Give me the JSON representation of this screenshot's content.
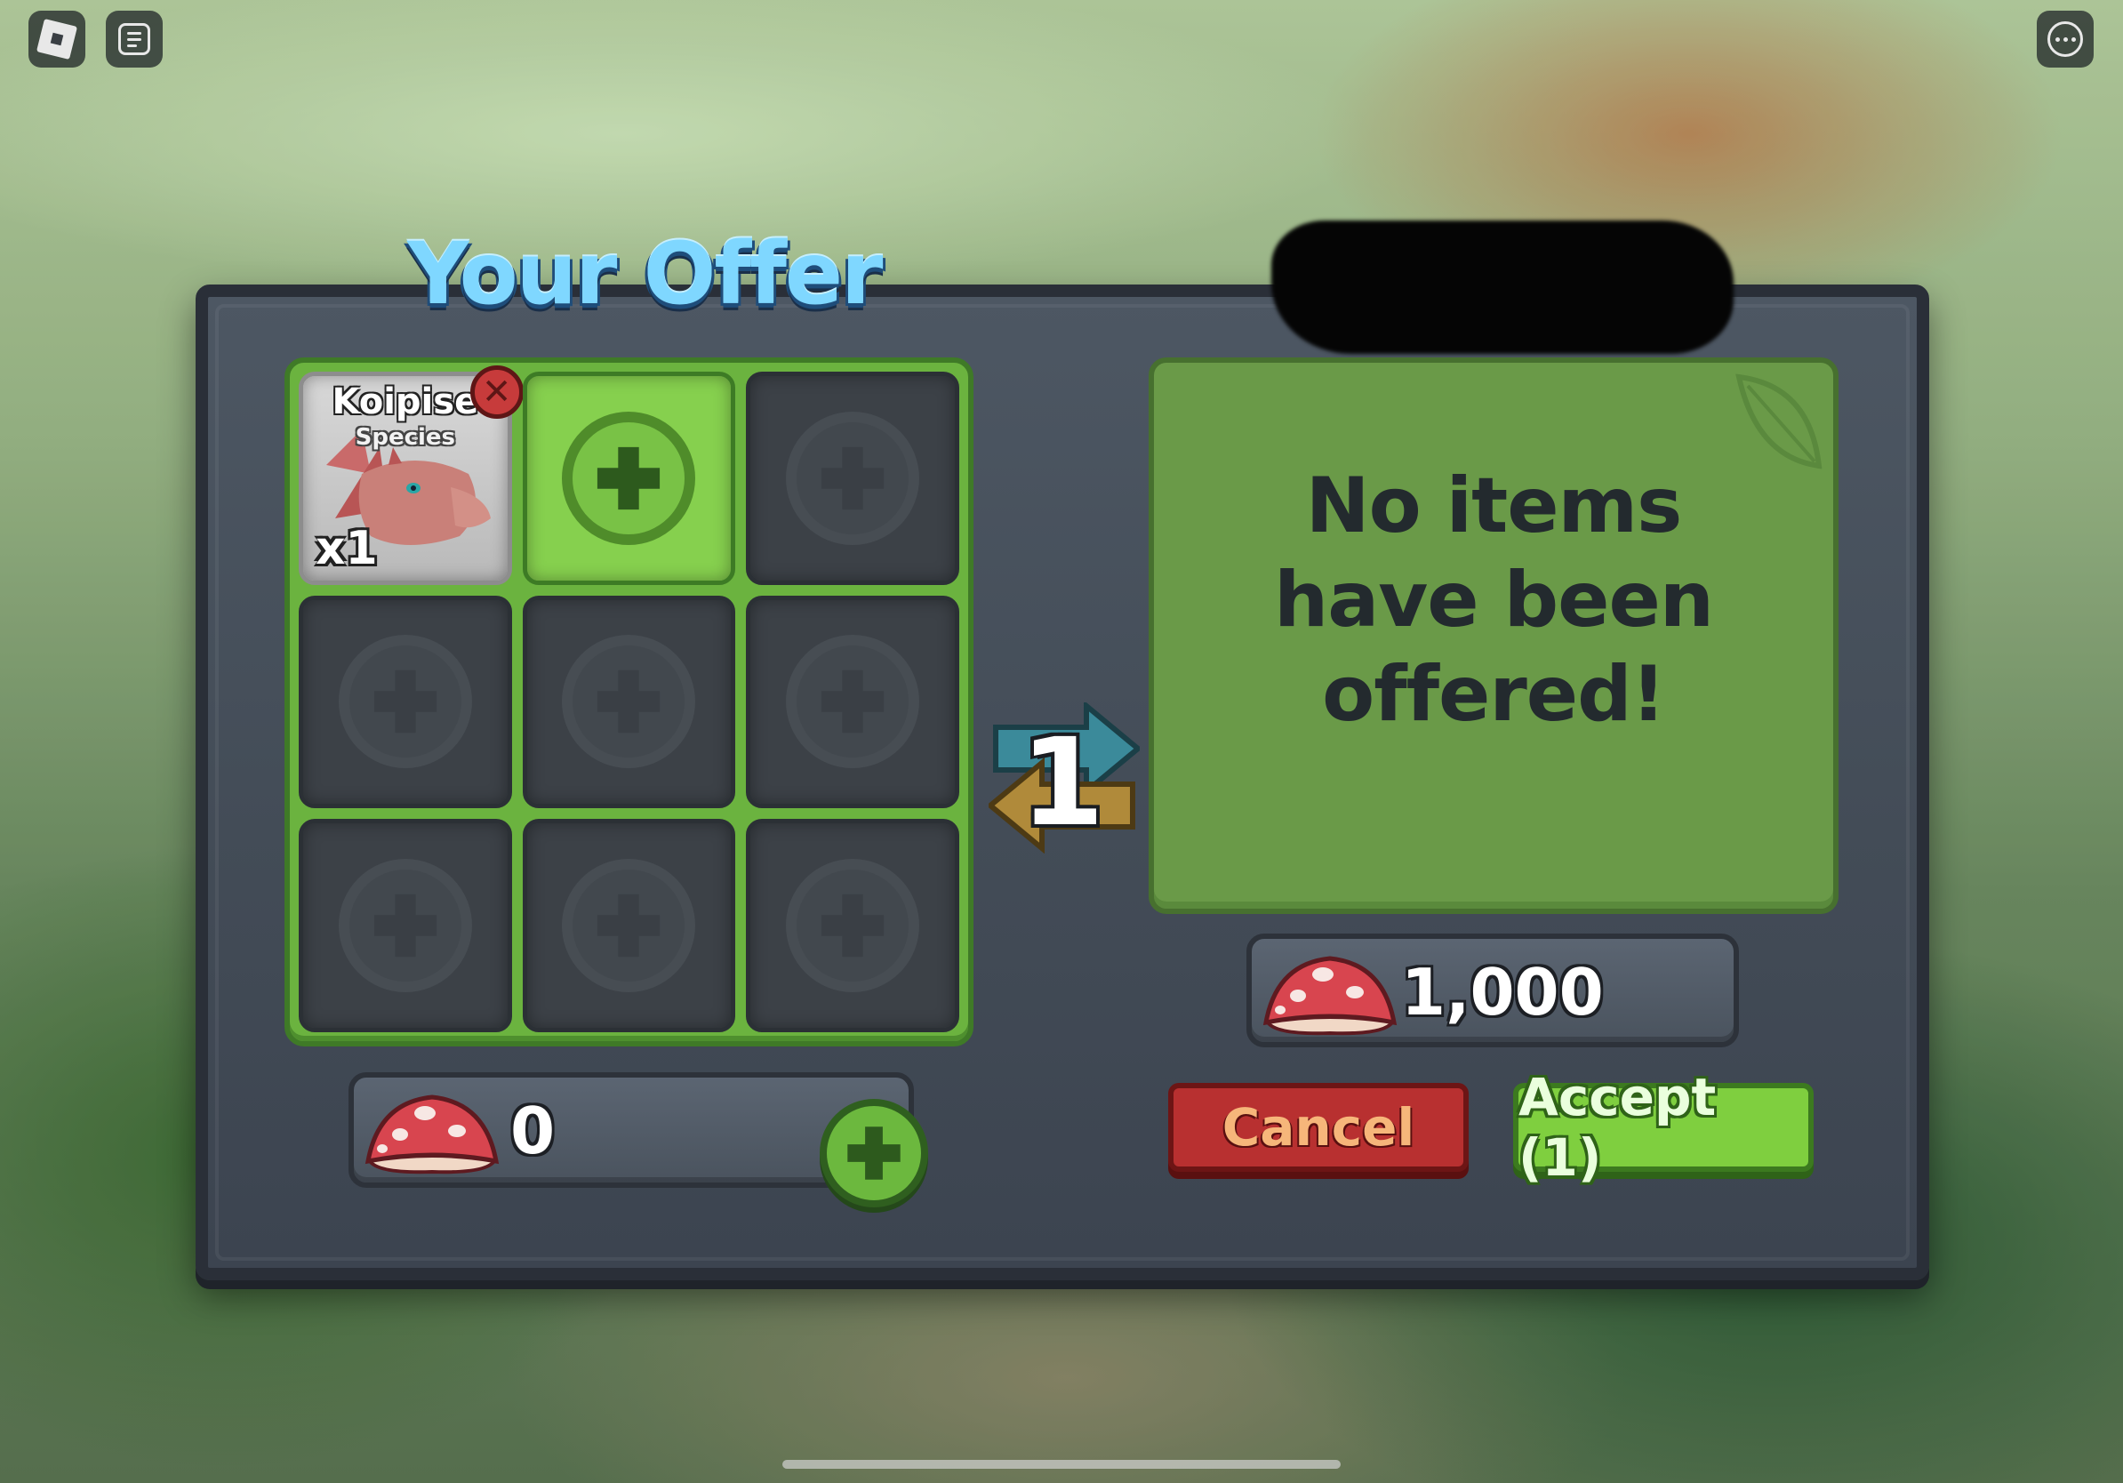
{
  "topbar": {
    "roblox_icon": "roblox-logo-icon",
    "chat_icon": "chat-icon",
    "menu_icon": "more-options-icon"
  },
  "your_offer": {
    "title": "Your Offer",
    "items": [
      {
        "name": "Koipise",
        "type": "Species",
        "quantity": "x1"
      }
    ],
    "slot_count": 9,
    "currency_amount": "0"
  },
  "their_offer": {
    "empty_message": "No items have been offered!",
    "currency_amount": "1,000"
  },
  "swap_count": "1",
  "buttons": {
    "cancel": "Cancel",
    "accept": "Accept (1)"
  },
  "colors": {
    "title": "#7fd7ff",
    "offer_green": "#6bb33f",
    "cancel_red": "#b83030",
    "accept_green": "#7fcf3f"
  }
}
